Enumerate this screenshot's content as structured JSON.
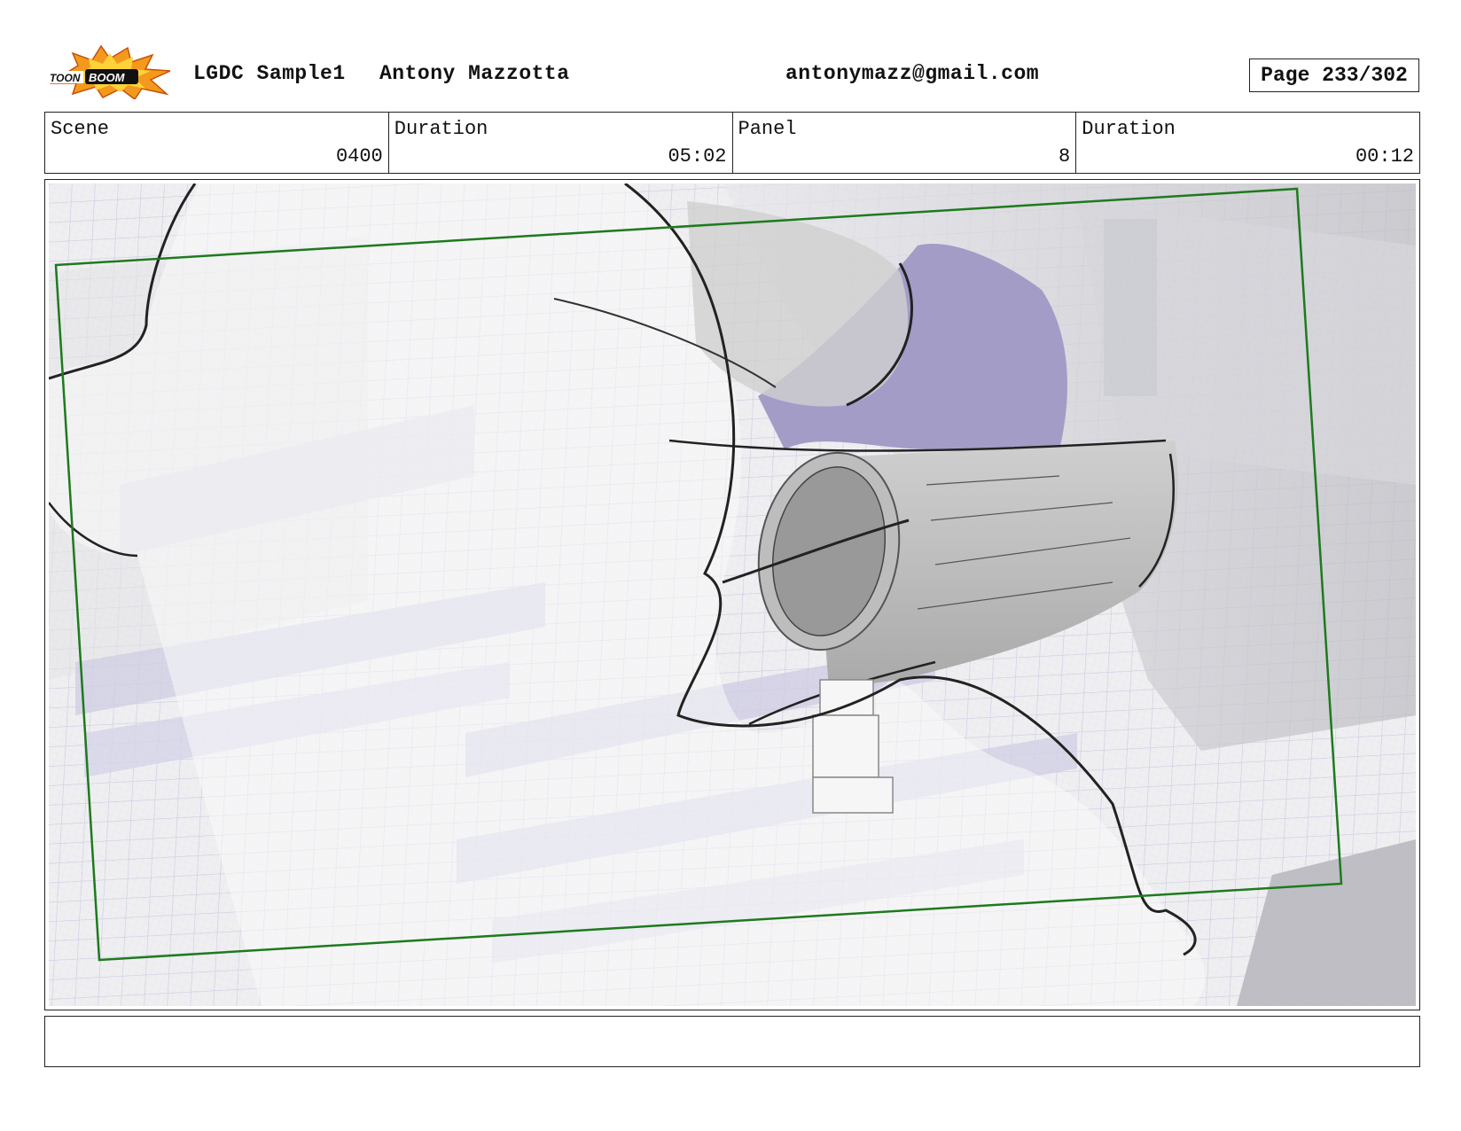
{
  "header": {
    "logo_text": "TOON BOOM",
    "project": "LGDC Sample1",
    "author": "Antony Mazzotta",
    "email": "antonymazz@gmail.com",
    "page_label": "Page 233/302"
  },
  "info": {
    "scene_label": "Scene",
    "scene_value": "0400",
    "scene_duration_label": "Duration",
    "scene_duration_value": "05:02",
    "panel_label": "Panel",
    "panel_value": "8",
    "panel_duration_label": "Duration",
    "panel_duration_value": "00:12"
  },
  "panel": {
    "icon": "storyboard-sketch",
    "accent_purple": "#a39cc7",
    "camera_frame_color": "#1e7a1e"
  },
  "caption": {
    "text": ""
  }
}
